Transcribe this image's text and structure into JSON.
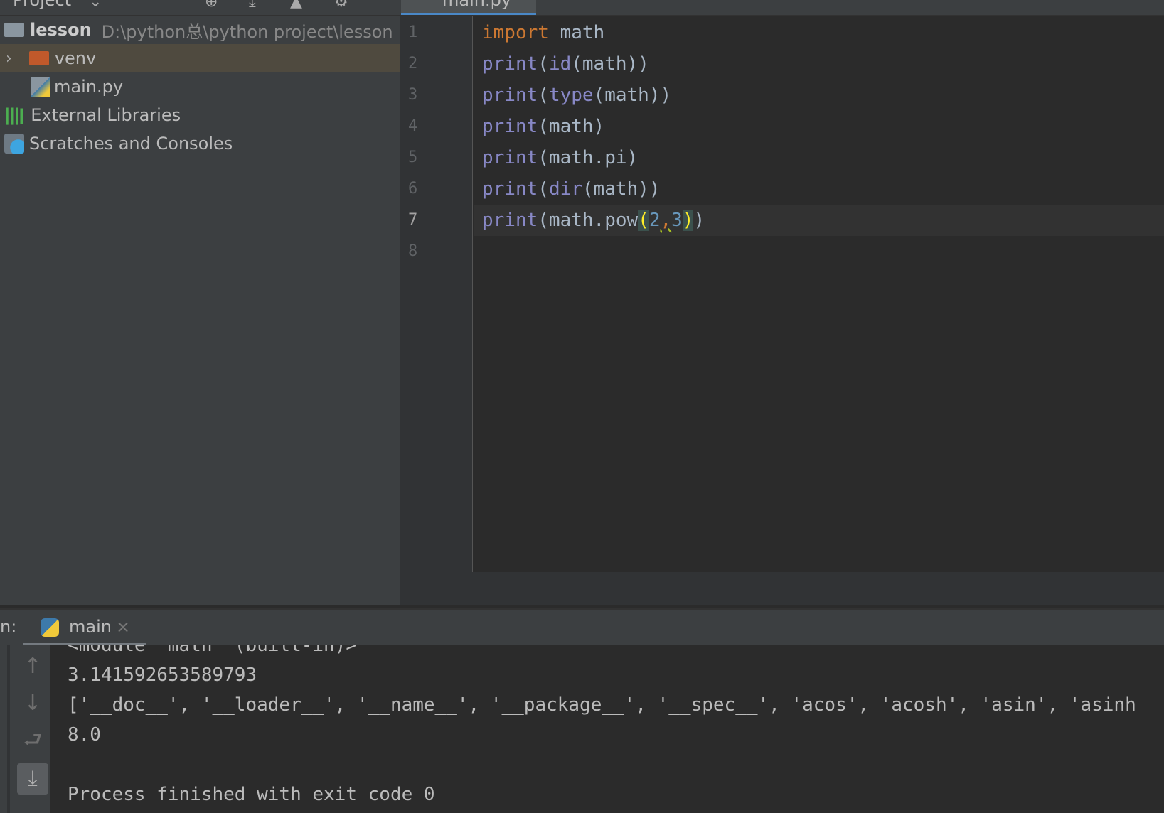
{
  "project_panel": {
    "title": "Project",
    "root": {
      "name": "lesson",
      "path": "D:\\python总\\python project\\lesson"
    },
    "items": [
      {
        "label": "venv",
        "type": "folder",
        "selected": true
      },
      {
        "label": "main.py",
        "type": "python-file"
      },
      {
        "label": "External Libraries"
      },
      {
        "label": "Scratches and Consoles"
      }
    ]
  },
  "editor": {
    "tab": "main.py",
    "current_line": 7,
    "lines": [
      [
        [
          "k",
          "import"
        ],
        [
          "",
          "math"
        ]
      ],
      [
        [
          "b",
          "print"
        ],
        [
          "",
          "("
        ],
        [
          "b",
          "id"
        ],
        [
          "",
          "(math))"
        ]
      ],
      [
        [
          "b",
          "print"
        ],
        [
          "",
          "("
        ],
        [
          "b",
          "type"
        ],
        [
          "",
          "(math))"
        ]
      ],
      [
        [
          "b",
          "print"
        ],
        [
          "",
          "(math)"
        ]
      ],
      [
        [
          "b",
          "print"
        ],
        [
          "",
          "(math.pi)"
        ]
      ],
      [
        [
          "b",
          "print"
        ],
        [
          "",
          "("
        ],
        [
          "b",
          "dir"
        ],
        [
          "",
          "(math))"
        ]
      ],
      [
        [
          "b",
          "print"
        ],
        [
          "",
          "(math.pow"
        ],
        [
          "br",
          "("
        ],
        [
          "n",
          "2"
        ],
        [
          "cm",
          ","
        ],
        [
          "n",
          "3"
        ],
        [
          "caret",
          ""
        ],
        [
          "br",
          ")"
        ],
        [
          "",
          ")"
        ]
      ],
      []
    ]
  },
  "run": {
    "label": "n:",
    "tab": "main",
    "output": [
      "<module 'math' (built-in)>",
      "3.141592653589793",
      "['__doc__', '__loader__', '__name__', '__package__', '__spec__', 'acos', 'acosh', 'asin', 'asinh",
      "8.0",
      "",
      "Process finished with exit code 0"
    ]
  },
  "colors": {
    "keyword": "#cc7832",
    "builtin": "#8888c6",
    "number": "#6897bb",
    "text": "#a9b7c6",
    "accent": "#4a88c7"
  }
}
